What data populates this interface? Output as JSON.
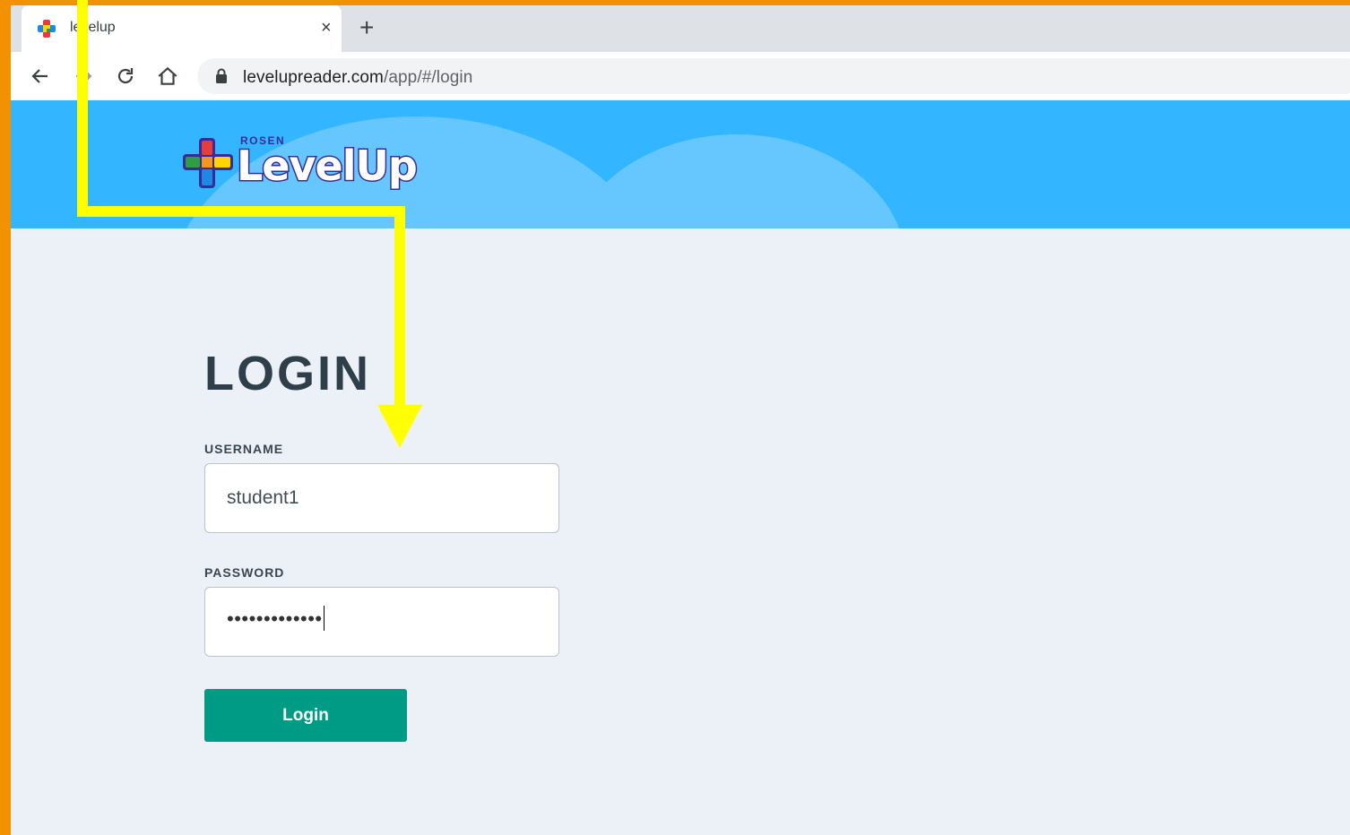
{
  "browser": {
    "tab_title": "levelup",
    "new_tab_label": "+",
    "close_label": "×",
    "url_host": "levelupreader.com",
    "url_path": "/app/#/login"
  },
  "brand": {
    "small_label": "ROSEN",
    "name": "LevelUp"
  },
  "login": {
    "title": "LOGIN",
    "username_label": "USERNAME",
    "username_value": "student1",
    "password_label": "PASSWORD",
    "password_masked": "•••••••••••••",
    "button_label": "Login"
  },
  "colors": {
    "page_frame": "#f39200",
    "banner": "#33b6ff",
    "button": "#009b84",
    "annotation": "#ffff00"
  },
  "icons": [
    "back-arrow-icon",
    "forward-arrow-icon",
    "reload-icon",
    "home-icon",
    "lock-icon",
    "close-icon",
    "plus-icon"
  ]
}
